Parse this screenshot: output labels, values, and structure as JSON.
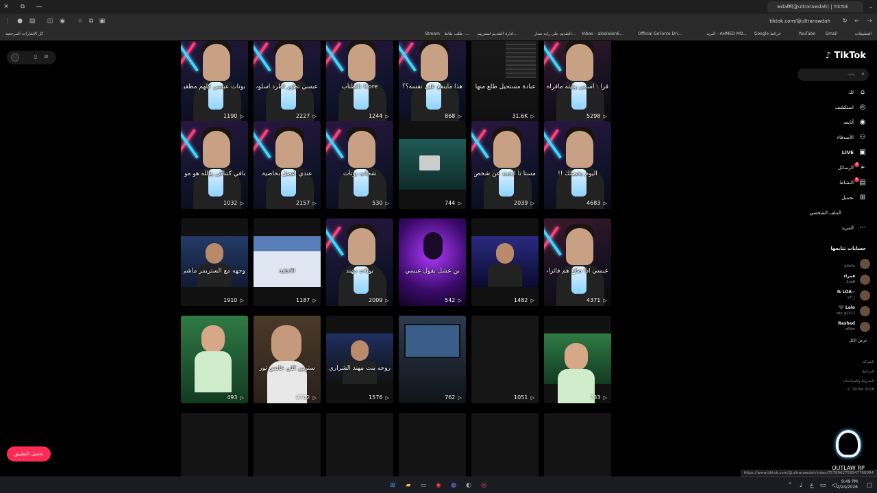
{
  "browser": {
    "tab_title": "wdah (@ultrarawdah) | TikTok",
    "url": "tiktok.com/@ultrarawdah",
    "status_url": "https://www.tiktok.com/@ultrarawdah/video/7578962759547768084",
    "bookmarks": [
      "التطبيقات",
      "Gmail",
      "YouTube",
      "Google خرائط",
      "البريد - AHMED MO...",
      "Official GeForce Dri...",
      "Inbox – alosiwien6...",
      "التقديم على راية ستار...",
      "ادارة التقديم لسترييم...",
      "طلب نقاط -...",
      "Stream"
    ],
    "bookmarks_all": "كل الإشارات المرجعية"
  },
  "sidebar": {
    "logo": "TikTok",
    "search_placeholder": "بحث",
    "nav": [
      {
        "label": "لك",
        "icon": "home-icon",
        "glyph": "⌂"
      },
      {
        "label": "استكشف",
        "icon": "compass-icon",
        "glyph": "◎"
      },
      {
        "label": "أتابعه",
        "icon": "following-icon",
        "glyph": "◉"
      },
      {
        "label": "الأصدقاء",
        "icon": "friends-icon",
        "glyph": "⚇"
      },
      {
        "label": "LIVE",
        "icon": "live-icon",
        "glyph": "▣"
      },
      {
        "label": "الرسائل",
        "icon": "messages-icon",
        "glyph": "➢",
        "badge": "2"
      },
      {
        "label": "النشاط",
        "icon": "activity-icon",
        "glyph": "▤",
        "badge": "5"
      },
      {
        "label": "تحميل",
        "icon": "upload-icon",
        "glyph": "⊞"
      },
      {
        "label": "الملف الشخصي",
        "icon": "profile-icon",
        "glyph": ""
      },
      {
        "label": "المزيد",
        "icon": "more-icon",
        "glyph": "⋯"
      }
    ],
    "following_header": "حسابات تتابعها",
    "accounts": [
      {
        "name": "",
        "handle": "qtla3x"
      },
      {
        "name": "قمراء",
        "handle": "2ue8"
      },
      {
        "name": "~LOA ℞",
        "handle": "x7l_i"
      },
      {
        "name": "Lolo 🖤",
        "handle": "lolo_g2511"
      },
      {
        "name": "Rashed",
        "handle": "z69m"
      }
    ],
    "show_all": "عرض الكل",
    "footer": [
      "الشركة",
      "البرنامج",
      "الشروط والسياسات",
      "TikTok 2026 ©"
    ]
  },
  "get_app": "تحميل التطبيق",
  "watermark": "OUTLAW RP",
  "videos": [
    {
      "caption": "بوتات عبسي كلهم مطقين",
      "views": "1190",
      "style": "person"
    },
    {
      "caption": "عبسي تطور اطرد اسلوب من البث",
      "views": "2227",
      "style": "person"
    },
    {
      "caption": "Core :الطناب",
      "views": "1244",
      "style": "person"
    },
    {
      "caption": "هذا ماينفع على نفسه؟؟",
      "views": "868",
      "style": "person"
    },
    {
      "caption": "عبادة مستحيل طلع منها حي",
      "views": "31.6K",
      "style": "chat"
    },
    {
      "caption": "قرأ : اسمي وليته ماقراه",
      "views": "5298",
      "style": "person2"
    },
    {
      "caption": "باقي كنتاكي والله هو مولاي",
      "views": "1032",
      "style": "person"
    },
    {
      "caption": "عندي افضل بخاصية",
      "views": "2157",
      "style": "person"
    },
    {
      "caption": "شحات بوتات",
      "views": "530",
      "style": "person"
    },
    {
      "caption": "",
      "views": "744",
      "style": "desk"
    },
    {
      "caption": "مستأ نا ابحث عن شخص",
      "views": "2039",
      "style": "person"
    },
    {
      "caption": "اليوم بحصلك !!",
      "views": "4683",
      "style": "person"
    },
    {
      "caption": "وجهه مع الستريمر ماشي",
      "views": "1910",
      "style": "stream"
    },
    {
      "caption": "الاجابة",
      "views": "1187",
      "style": "quiz"
    },
    {
      "caption": "بوتات مهند",
      "views": "2009",
      "style": "person"
    },
    {
      "caption": "بن عشل بقول عبسي",
      "views": "542",
      "style": "purple"
    },
    {
      "caption": "",
      "views": "1482",
      "style": "stream2"
    },
    {
      "caption": "عبسي اذا ضاع هم فائزات يدعو",
      "views": "4371",
      "style": "person2"
    },
    {
      "caption": "",
      "views": "493",
      "style": "green"
    },
    {
      "caption": "سترين كلي عابس ثور",
      "views": "9762",
      "style": "man"
    },
    {
      "caption": "روحه بنت مهند الشراري؟؟",
      "views": "1576",
      "style": "stream3"
    },
    {
      "caption": "",
      "views": "762",
      "style": "screen"
    },
    {
      "caption": "",
      "views": "1051",
      "style": "blank"
    },
    {
      "caption": "",
      "views": "733",
      "style": "green2"
    },
    {
      "caption": "",
      "views": "",
      "style": "empty"
    },
    {
      "caption": "",
      "views": "",
      "style": "empty"
    },
    {
      "caption": "",
      "views": "",
      "style": "empty"
    },
    {
      "caption": "",
      "views": "",
      "style": "empty"
    },
    {
      "caption": "",
      "views": "",
      "style": "empty"
    },
    {
      "caption": "",
      "views": "",
      "style": "empty"
    }
  ],
  "taskbar": {
    "time": "9:49 PM",
    "date": "2/24/2026"
  }
}
